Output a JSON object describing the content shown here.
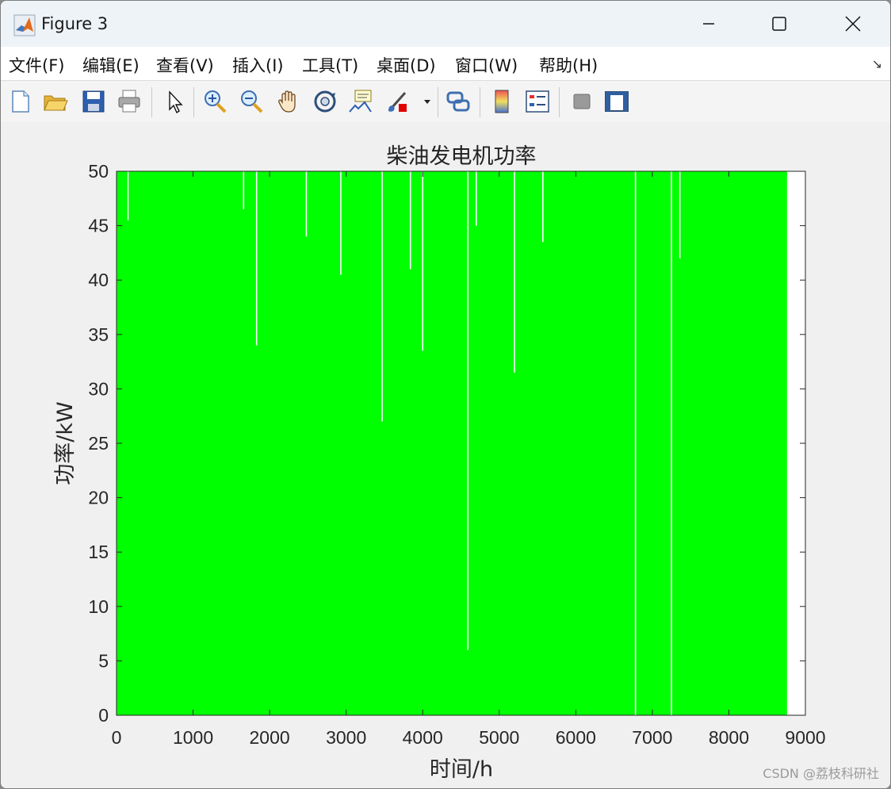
{
  "window": {
    "title": "Figure 3",
    "icon": "matlab-icon",
    "controls": [
      "minimize-icon",
      "maximize-icon",
      "close-icon"
    ]
  },
  "menu": {
    "items": [
      "文件(F)",
      "编辑(E)",
      "查看(V)",
      "插入(I)",
      "工具(T)",
      "桌面(D)",
      "窗口(W)",
      "帮助(H)"
    ],
    "dock_icon": "dock-arrow-icon"
  },
  "toolbar": {
    "icons": [
      "new-figure-icon",
      "open-file-icon",
      "save-icon",
      "print-icon",
      "pointer-icon",
      "zoom-in-icon",
      "zoom-out-icon",
      "pan-hand-icon",
      "rotate-3d-icon",
      "data-cursor-icon",
      "brush-icon",
      "link-plot-icon",
      "colorbar-icon",
      "legend-icon",
      "hide-plot-tools-icon",
      "show-plot-tools-icon"
    ]
  },
  "chart_data": {
    "type": "area",
    "title": "柴油发电机功率",
    "xlabel": "时间/h",
    "ylabel": "功率/kW",
    "xlim": [
      0,
      9000
    ],
    "ylim": [
      0,
      50
    ],
    "xticks": [
      "0",
      "1000",
      "2000",
      "3000",
      "4000",
      "5000",
      "6000",
      "7000",
      "8000",
      "9000"
    ],
    "yticks": [
      "0",
      "5",
      "10",
      "15",
      "20",
      "25",
      "30",
      "35",
      "40",
      "45",
      "50"
    ],
    "grid": false,
    "series": [
      {
        "color": "#00ff00",
        "x_range": [
          0,
          8760
        ],
        "base_value": 50,
        "dips": [
          {
            "x": 150,
            "y": 45.5
          },
          {
            "x": 1660,
            "y": 46.5
          },
          {
            "x": 1830,
            "y": 34
          },
          {
            "x": 2480,
            "y": 44
          },
          {
            "x": 2930,
            "y": 40.5
          },
          {
            "x": 3470,
            "y": 27
          },
          {
            "x": 3840,
            "y": 41
          },
          {
            "x": 4000,
            "y": 33.5
          },
          {
            "x": 4590,
            "y": 6
          },
          {
            "x": 4700,
            "y": 45
          },
          {
            "x": 5200,
            "y": 31.5
          },
          {
            "x": 5570,
            "y": 43.5
          },
          {
            "x": 6780,
            "y": 0
          },
          {
            "x": 7250,
            "y": 0
          },
          {
            "x": 7360,
            "y": 42
          }
        ]
      }
    ]
  },
  "watermark": "CSDN @荔枝科研社"
}
